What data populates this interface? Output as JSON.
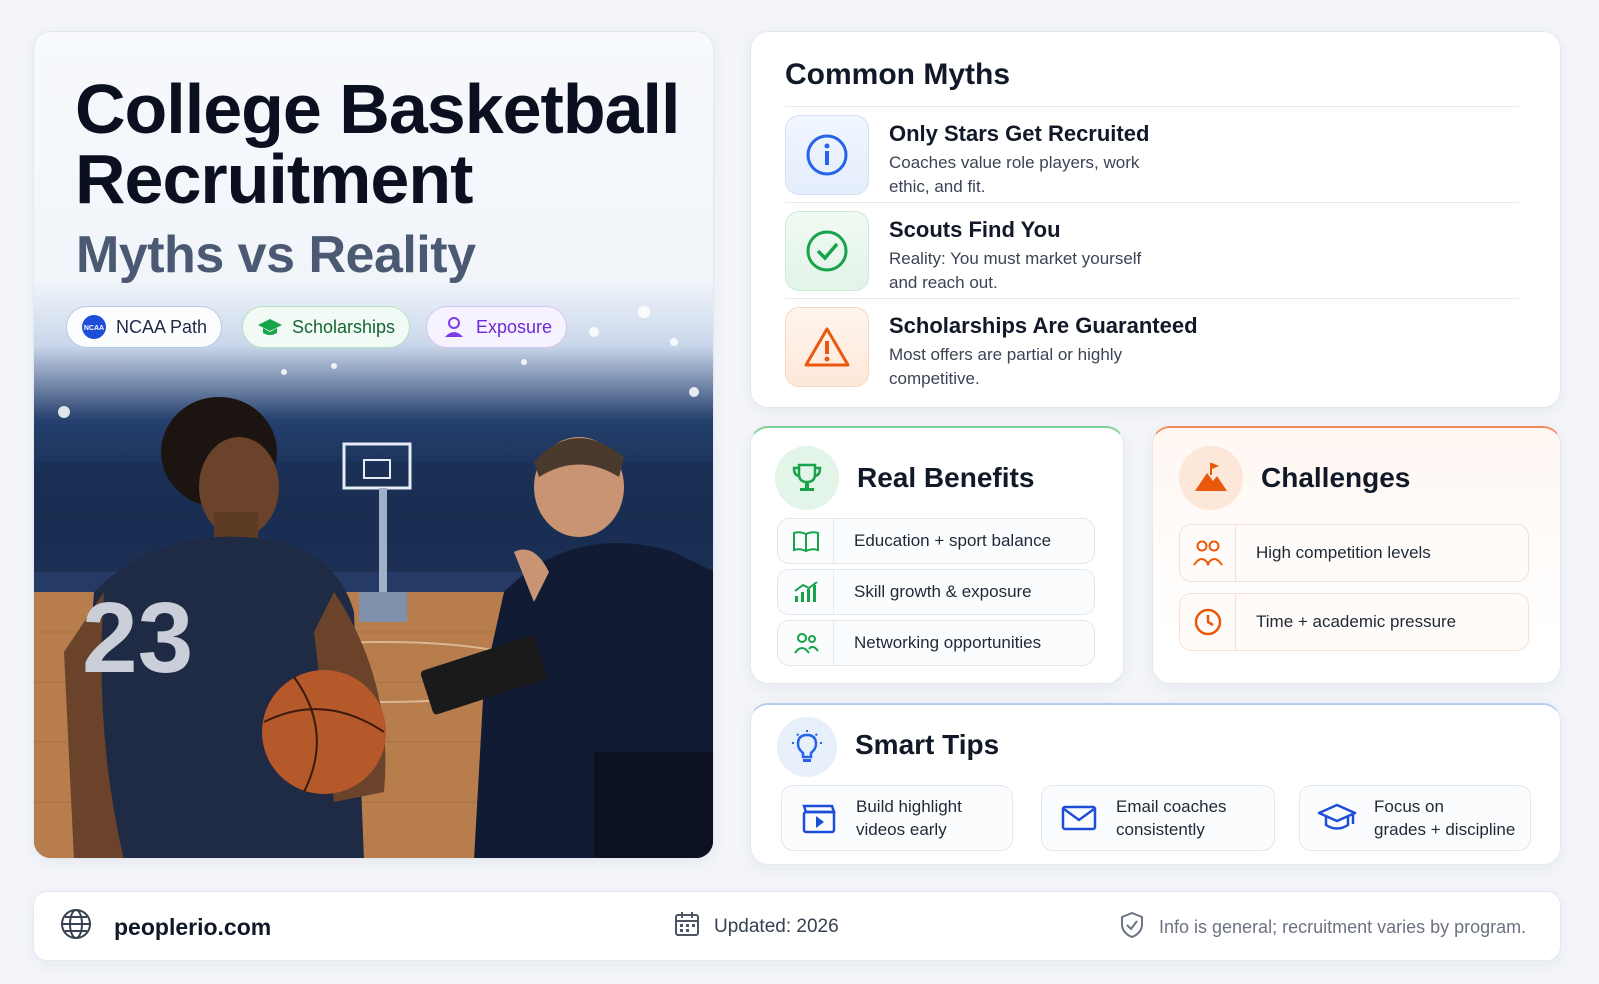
{
  "hero": {
    "title": "College Basketball Recruitment",
    "subtitle": "Myths vs Reality",
    "chips": [
      {
        "label": "NCAA Path",
        "icon": "ncaa-logo-icon"
      },
      {
        "label": "Scholarships",
        "icon": "graduation-cap-icon"
      },
      {
        "label": "Exposure",
        "icon": "person-icon"
      }
    ],
    "jersey_number": "23",
    "ncaa_logo_text": "NCAA"
  },
  "myths": {
    "title": "Common Myths",
    "items": [
      {
        "heading": "Only Stars Get Recruited",
        "description": "Coaches value role players, work ethic, and fit.",
        "icon": "info-icon",
        "color": "#2563eb"
      },
      {
        "heading": "Scouts Find You",
        "description": "Reality: You must market yourself and reach out.",
        "icon": "check-circle-icon",
        "color": "#16a34a"
      },
      {
        "heading": "Scholarships Are Guaranteed",
        "description": "Most offers are partial or highly competitive.",
        "icon": "warning-triangle-icon",
        "color": "#ea580c"
      }
    ]
  },
  "benefits": {
    "title": "Real Benefits",
    "icon": "trophy-icon",
    "accent": "#16a34a",
    "items": [
      {
        "label": "Education + sport balance",
        "icon": "book-icon"
      },
      {
        "label": "Skill growth & exposure",
        "icon": "growth-chart-icon"
      },
      {
        "label": "Networking opportunities",
        "icon": "people-icon"
      }
    ]
  },
  "challenges": {
    "title": "Challenges",
    "icon": "mountain-flag-icon",
    "accent": "#ea580c",
    "items": [
      {
        "label": "High competition levels",
        "icon": "people-icon"
      },
      {
        "label": "Time + academic pressure",
        "icon": "clock-icon"
      }
    ]
  },
  "tips": {
    "title": "Smart Tips",
    "icon": "lightbulb-icon",
    "accent": "#2563eb",
    "items": [
      {
        "line1": "Build highlight",
        "line2": "videos early",
        "icon": "video-clapper-icon"
      },
      {
        "line1": "Email coaches",
        "line2": "consistently",
        "icon": "envelope-icon"
      },
      {
        "line1": "Focus on",
        "line2": "grades + discipline",
        "icon": "graduation-cap-icon"
      }
    ]
  },
  "footer": {
    "site": "peoplerio.com",
    "updated": "Updated: 2026",
    "disclaimer": "Info is general; recruitment varies by program."
  }
}
